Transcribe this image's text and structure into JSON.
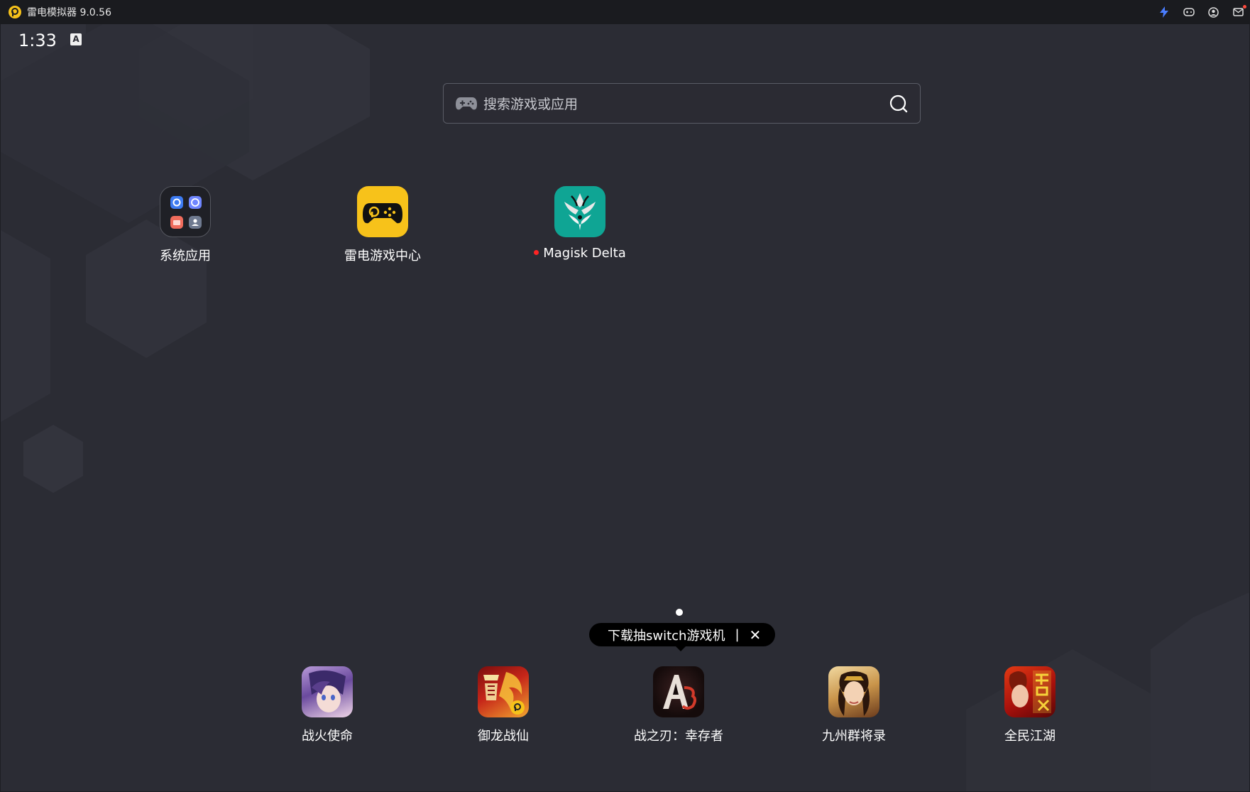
{
  "window": {
    "title": "雷电模拟器 9.0.56",
    "icons": [
      "lightning-icon",
      "gamepad-icon",
      "account-icon",
      "mail-icon"
    ]
  },
  "status_bar": {
    "time": "1:33",
    "keyboard_indicator": "A"
  },
  "search": {
    "placeholder": "搜索游戏或应用"
  },
  "apps": [
    {
      "label": "系统应用"
    },
    {
      "label": "雷电游戏中心"
    },
    {
      "label": "Magisk Delta",
      "new_badge": true
    }
  ],
  "tooltip": {
    "text": "下载抽switch游戏机",
    "separator": "|",
    "close": "✕"
  },
  "dock": [
    {
      "label": "战火使命"
    },
    {
      "label": "御龙战仙"
    },
    {
      "label": "战之刃：幸存者"
    },
    {
      "label": "九州群将录"
    },
    {
      "label": "全民江湖"
    }
  ],
  "colors": {
    "accent": "#f7c21a",
    "magisk_bg": "#0fa594",
    "background": "#2b2c34",
    "notification_dot": "#ff2424"
  }
}
